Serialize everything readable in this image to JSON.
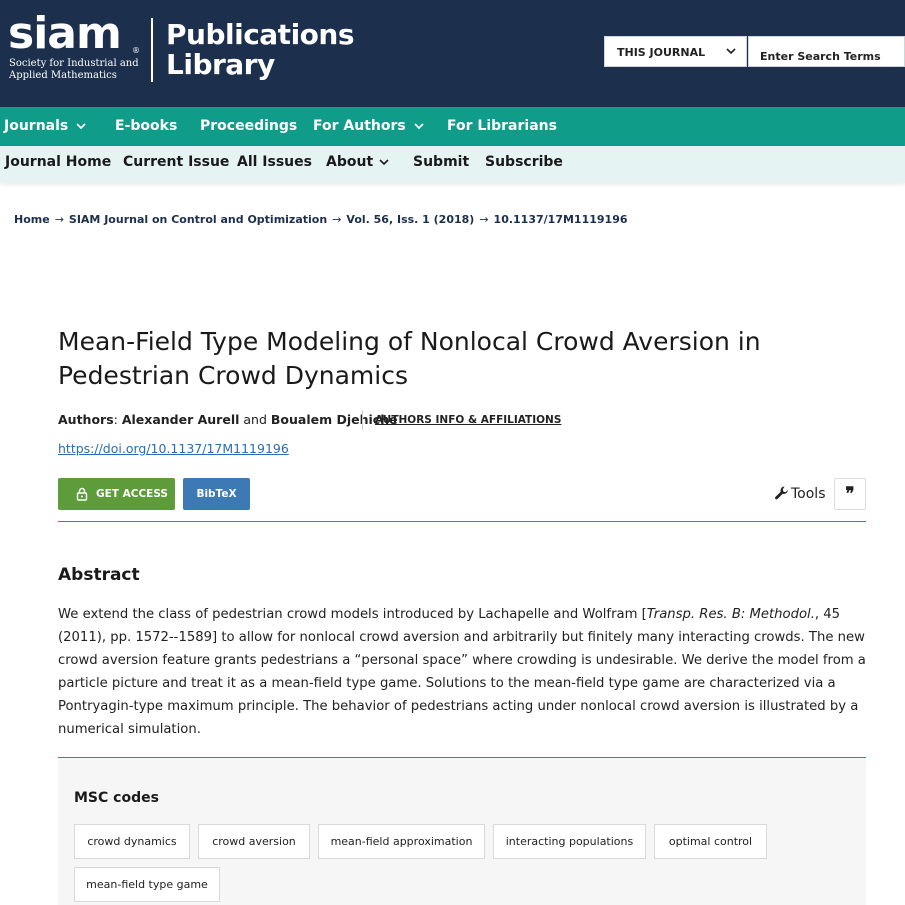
{
  "header": {
    "logo_word": "siam",
    "logo_registered": "®",
    "logo_subtitle_line1": "Society for Industrial and",
    "logo_subtitle_line2": "Applied Mathematics",
    "publications_line1": "Publications",
    "publications_line2": "Library",
    "search_scope": "THIS JOURNAL",
    "search_placeholder": "Enter Search Terms"
  },
  "primary_nav": {
    "items": [
      {
        "label": "Journals",
        "has_dropdown": true
      },
      {
        "label": "E-books",
        "has_dropdown": false
      },
      {
        "label": "Proceedings",
        "has_dropdown": false
      },
      {
        "label": "For Authors",
        "has_dropdown": true
      },
      {
        "label": "For Librarians",
        "has_dropdown": false
      }
    ]
  },
  "secondary_nav": {
    "items": [
      {
        "label": "Journal Home",
        "has_dropdown": false
      },
      {
        "label": "Current Issue",
        "has_dropdown": false
      },
      {
        "label": "All Issues",
        "has_dropdown": false
      },
      {
        "label": "About",
        "has_dropdown": true
      },
      {
        "label": "Submit",
        "has_dropdown": false
      },
      {
        "label": "Subscribe",
        "has_dropdown": false
      }
    ]
  },
  "breadcrumb": {
    "items": [
      "Home",
      "SIAM Journal on Control and Optimization",
      "Vol. 56, Iss. 1 (2018)",
      "10.1137/17M1119196"
    ],
    "separator": "→"
  },
  "article": {
    "title_line1": "Mean-Field Type Modeling of Nonlocal Crowd Aversion in",
    "title_line2": "Pedestrian Crowd Dynamics",
    "authors_label": "Authors",
    "author1": "Alexander Aurell",
    "authors_and": "and",
    "author2": "Boualem Djehiche",
    "authors_info": "AUTHORS INFO & AFFILIATIONS",
    "doi": "https://doi.org/10.1137/17M1119196",
    "get_access": "GET ACCESS",
    "bibtex": "BibTeX",
    "tools": "Tools",
    "cite_glyph": "❞"
  },
  "abstract": {
    "heading": "Abstract",
    "part1": "We extend the class of pedestrian crowd models introduced by Lachapelle and Wolfram [",
    "journal_italic": "Transp. Res. B: Methodol.",
    "part2": ", 45 (2011), pp. 1572--1589] to allow for nonlocal crowd aversion and arbitrarily but finitely many interacting crowds. The new crowd aversion feature grants pedestrians a “personal space” where crowding is undesirable. We derive the model from a particle picture and treat it as a mean-field type game. Solutions to the mean-field type game are characterized via a Pontryagin-type maximum principle. The behavior of pedestrians acting under nonlocal crowd aversion is illustrated by a numerical simulation."
  },
  "msc": {
    "heading": "MSC codes",
    "codes": [
      "crowd dynamics",
      "crowd aversion",
      "mean-field approximation",
      "interacting populations",
      "optimal control",
      "mean-field type game"
    ]
  },
  "colors": {
    "header_bg": "#1c2f4d",
    "primary_nav_bg": "#0f9d8a",
    "secondary_nav_bg": "#e6f3f3",
    "access_button": "#5e9b3a",
    "bibtex_button": "#3c79b5",
    "link": "#2a6db3"
  }
}
